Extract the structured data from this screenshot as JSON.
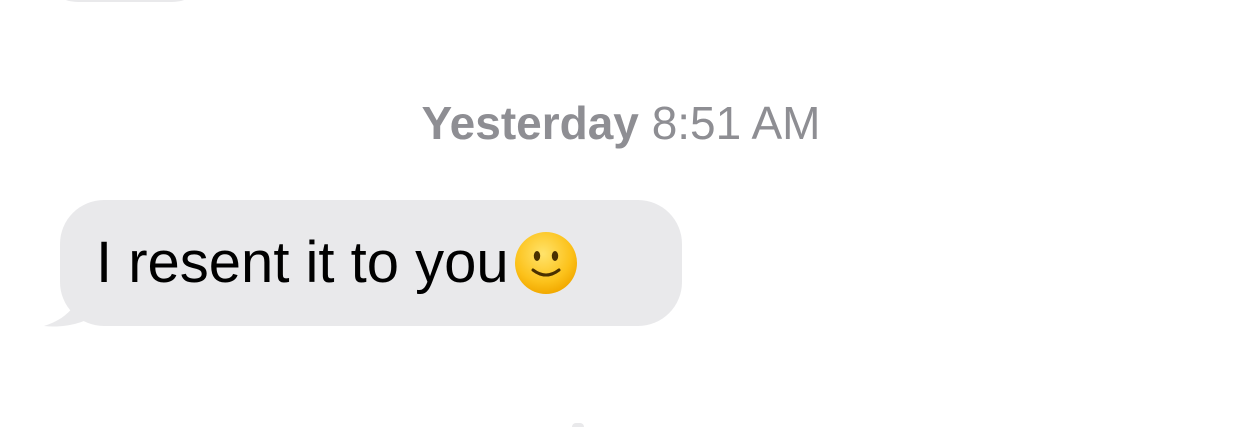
{
  "thread": {
    "timestamp": {
      "day": "Yesterday",
      "time": "8:51 AM"
    },
    "messages": [
      {
        "direction": "incoming",
        "text": "I resent it to you",
        "emoji_icon": "slightly-smiling-face-icon"
      }
    ]
  },
  "colors": {
    "incoming_bubble": "#e9e9eb",
    "timestamp_text": "#8e8e93",
    "message_text": "#000000",
    "background": "#ffffff"
  }
}
